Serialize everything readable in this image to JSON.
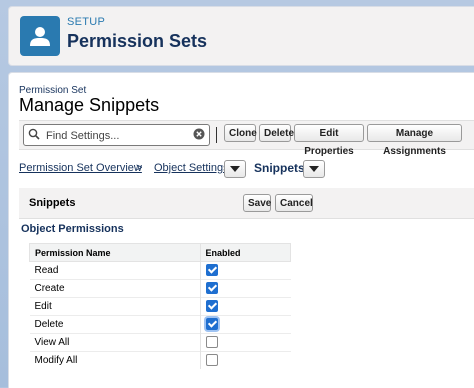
{
  "header": {
    "section_label": "SETUP",
    "title": "Permission Sets",
    "icon": "user-icon",
    "accent_color": "#2a7ab0"
  },
  "record": {
    "type_label": "Permission Set",
    "name": "Manage Snippets"
  },
  "toolbar": {
    "search_placeholder": "Find Settings...",
    "buttons": [
      "Clone",
      "Delete",
      "Edit Properties",
      "Manage Assignments"
    ]
  },
  "breadcrumb": {
    "overview": "Permission Set Overview",
    "separator": ">",
    "object_settings": "Object Settings",
    "current": "Snippets"
  },
  "section": {
    "title": "Snippets",
    "save_label": "Save",
    "cancel_label": "Cancel"
  },
  "object_permissions": {
    "title": "Object Permissions",
    "columns": [
      "Permission Name",
      "Enabled"
    ],
    "rows": [
      {
        "name": "Read",
        "enabled": true
      },
      {
        "name": "Create",
        "enabled": true
      },
      {
        "name": "Edit",
        "enabled": true
      },
      {
        "name": "Delete",
        "enabled": true
      },
      {
        "name": "View All",
        "enabled": false
      },
      {
        "name": "Modify All",
        "enabled": false
      }
    ]
  }
}
